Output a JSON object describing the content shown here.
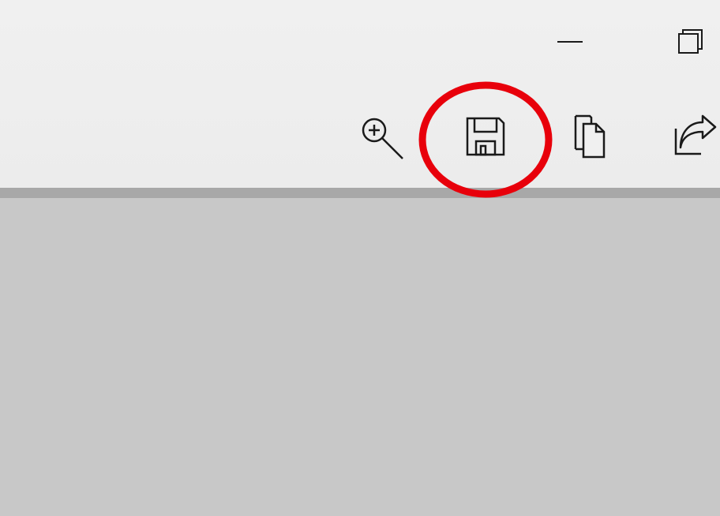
{
  "window_controls": {
    "minimize_icon": "minimize-icon",
    "restore_icon": "restore-icon"
  },
  "toolbar": {
    "buttons": [
      {
        "id": "zoom-in",
        "icon": "zoom-in-icon"
      },
      {
        "id": "save",
        "icon": "save-icon"
      },
      {
        "id": "copy",
        "icon": "copy-icon"
      },
      {
        "id": "share",
        "icon": "share-icon"
      }
    ]
  },
  "annotation": {
    "shape": "ellipse",
    "color": "#e8000b",
    "target": "save-button"
  },
  "colors": {
    "title_bar": "#f0f0f0",
    "divider": "#a8a8a8",
    "content": "#c8c8c8",
    "icon_stroke": "#1a1a1a"
  }
}
